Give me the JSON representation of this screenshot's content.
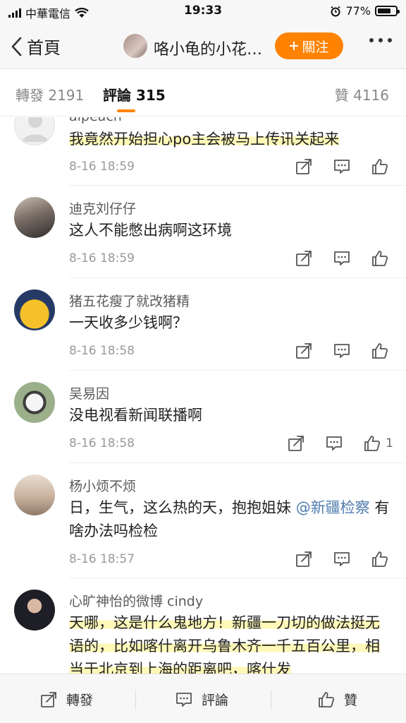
{
  "status_bar": {
    "carrier": "中華電信",
    "time": "19:33",
    "battery": "77%",
    "battery_level": 0.77
  },
  "nav": {
    "back_label": "首頁",
    "title": "咯小龟的小花…",
    "follow_label": "關注"
  },
  "tabs": [
    {
      "label": "轉發 2191"
    },
    {
      "label": "評論 315"
    },
    {
      "label": "贊 4116"
    }
  ],
  "comments": [
    {
      "user": "alpeach",
      "text": "我竟然开始担心po主会被马上传讯关起来",
      "time": "8-16 18:59",
      "likes": ""
    },
    {
      "user": "迪克刘仔仔",
      "text": "这人不能憋出病啊这环境",
      "time": "8-16 18:59",
      "likes": ""
    },
    {
      "user": "猪五花瘦了就改猪精",
      "text": "一天收多少钱啊？",
      "time": "8-16 18:58",
      "likes": ""
    },
    {
      "user": "吴易因",
      "text": "没电视看新闻联播啊",
      "time": "8-16 18:58",
      "likes": "1"
    },
    {
      "user": "杨小烦不烦",
      "text_before": "日，生气，这么热的天，抱抱姐妹 ",
      "mention": "@新疆检察",
      "text_after": " 有啥办法吗检检",
      "time": "8-16 18:57",
      "likes": ""
    },
    {
      "user": "心旷神怡的微博 cindy",
      "text": "天哪，这是什么鬼地方！新疆一刀切的做法挺无语的，比如喀什离开乌鲁木齐一千五百公里，相当于北京到上海的距离吧，喀什发",
      "time": "",
      "likes": ""
    }
  ],
  "bottom_bar": {
    "repost": "轉發",
    "comment": "評論",
    "like": "贊"
  },
  "icons": {
    "repost": "share-box-icon",
    "comment": "speech-bubble-icon",
    "like": "thumbs-up-icon"
  },
  "colors": {
    "accent": "#ff8200",
    "mention": "#507daf",
    "highlight": "#fff7b0"
  }
}
